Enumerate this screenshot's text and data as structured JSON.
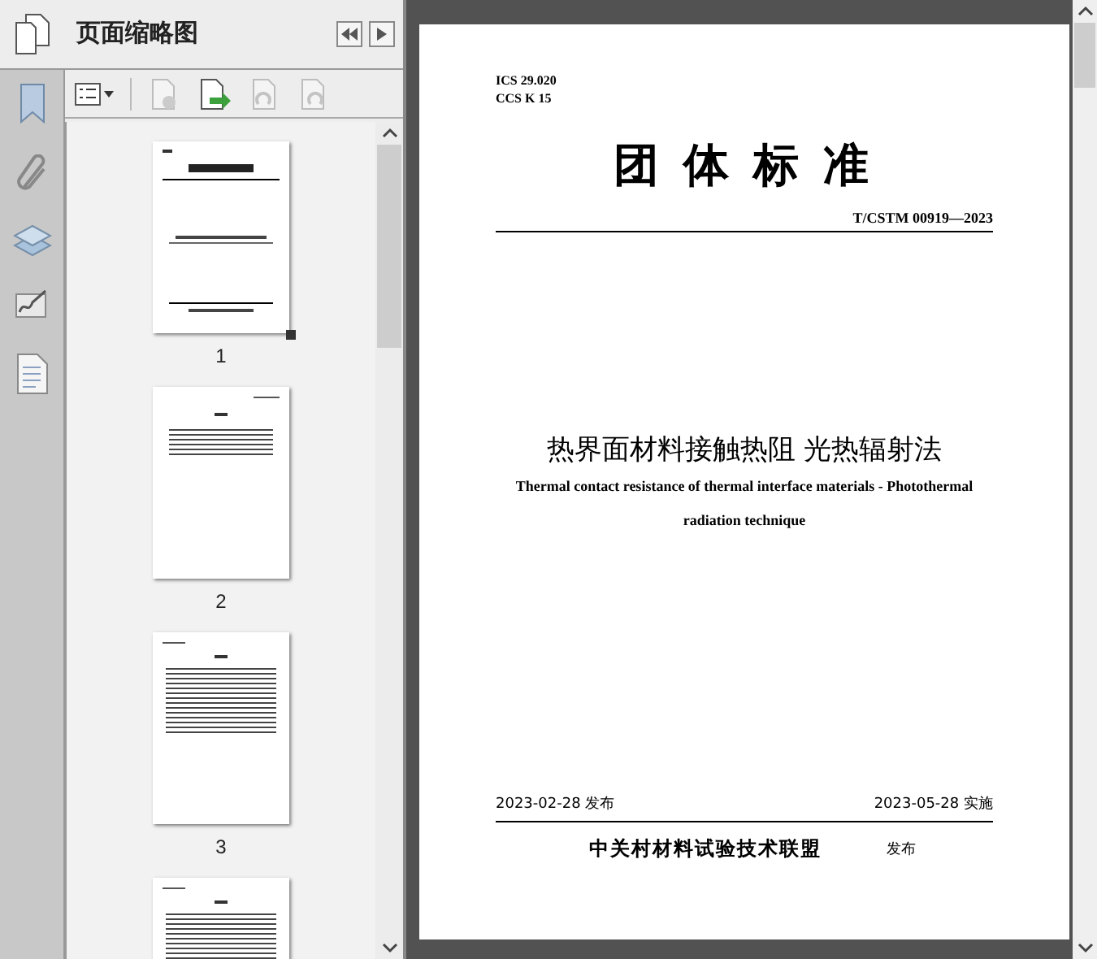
{
  "panel": {
    "title": "页面缩略图"
  },
  "thumbnails": [
    {
      "label": "1",
      "kind": "cover",
      "selected": true
    },
    {
      "label": "2",
      "kind": "foreword",
      "selected": false
    },
    {
      "label": "3",
      "kind": "text",
      "selected": false
    },
    {
      "kind": "text"
    }
  ],
  "document": {
    "ics": "ICS 29.020",
    "ccs": "CCS K 15",
    "heading": "团 体 标 准",
    "standard_number": "T/CSTM 00919—2023",
    "title_zh": "热界面材料接触热阻 光热辐射法",
    "title_en_line_1": "Thermal contact resistance of thermal interface materials - Photothermal",
    "title_en_line_2": "radiation technique",
    "publish_date": "2023-02-28 发布",
    "effective_date": "2023-05-28 实施",
    "publisher": "中关村材料试验技术联盟",
    "publisher_suffix": "发布"
  }
}
